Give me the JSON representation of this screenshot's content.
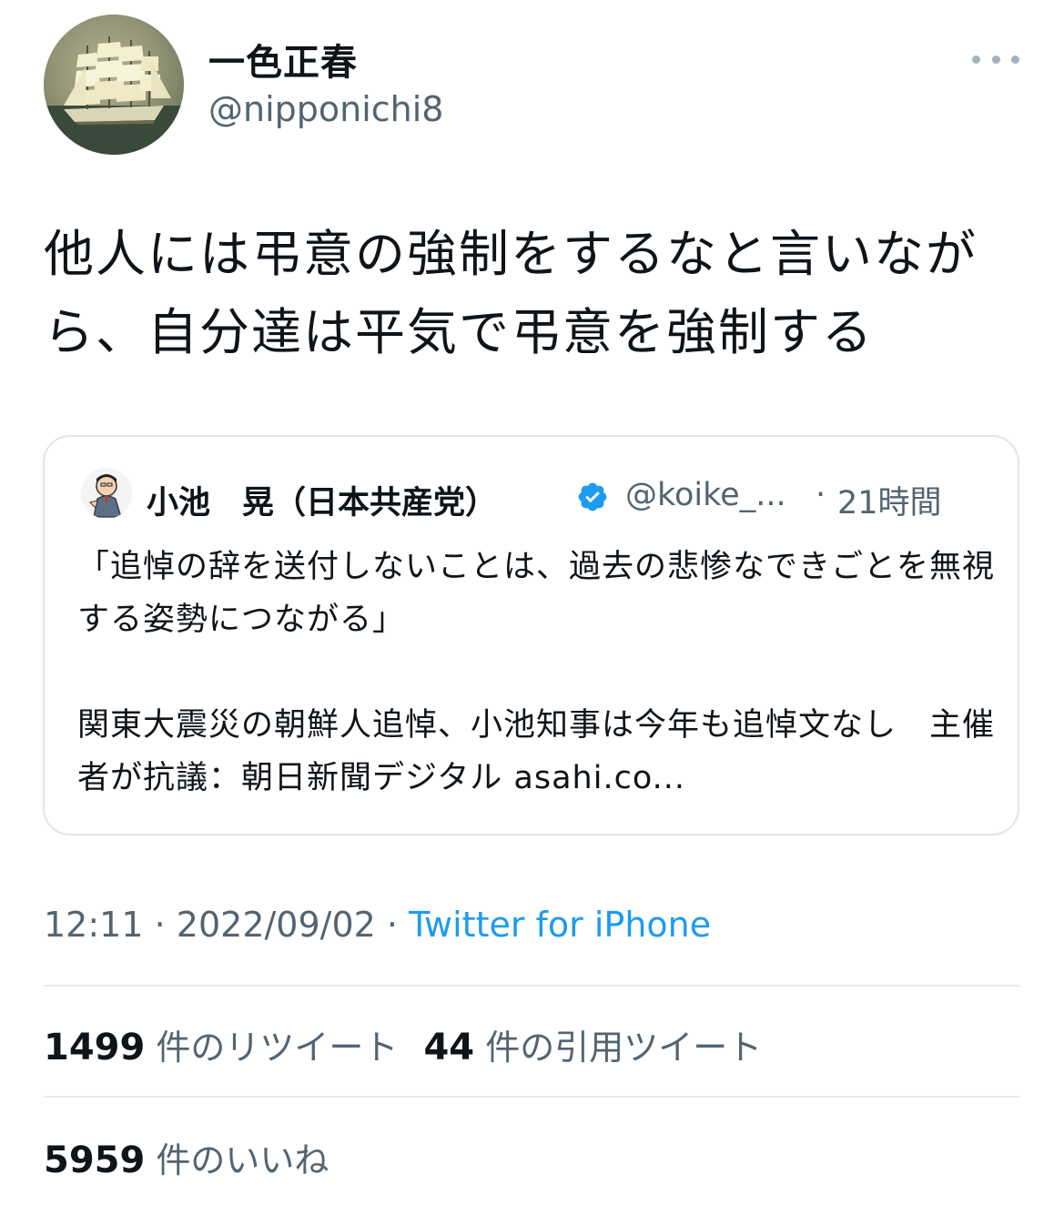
{
  "user": {
    "display_name": "一色正春",
    "handle": "@nipponichi8"
  },
  "tweet": {
    "text": "他人には弔意の強制をするなと言いながら、自分達は平気で弔意を強制する",
    "time": "12:11",
    "date": "2022/09/02",
    "separator": "·",
    "source": "Twitter for iPhone"
  },
  "quote": {
    "name": "小池　晃（日本共産党）",
    "handle": "@koike_...",
    "separator": "·",
    "time": "21時間",
    "paragraph1": "「追悼の辞を送付しないことは、過去の悲惨なできごとを無視する姿勢につながる」",
    "paragraph2": "関東大震災の朝鮮人追悼、小池知事は今年も追悼文なし　主催者が抗議：朝日新聞デジタル asahi.co..."
  },
  "stats": {
    "retweets_count": "1499",
    "retweets_label": "件のリツイート",
    "quotes_count": "44",
    "quotes_label": "件の引用ツイート",
    "likes_count": "5959",
    "likes_label": "件のいいね"
  },
  "colors": {
    "text": "#0f1419",
    "secondary": "#536471",
    "accent": "#1d9bf0",
    "border": "#e1e6ea"
  },
  "icons": {
    "more": "more-horizontal-icon",
    "verified": "verified-badge-icon"
  }
}
